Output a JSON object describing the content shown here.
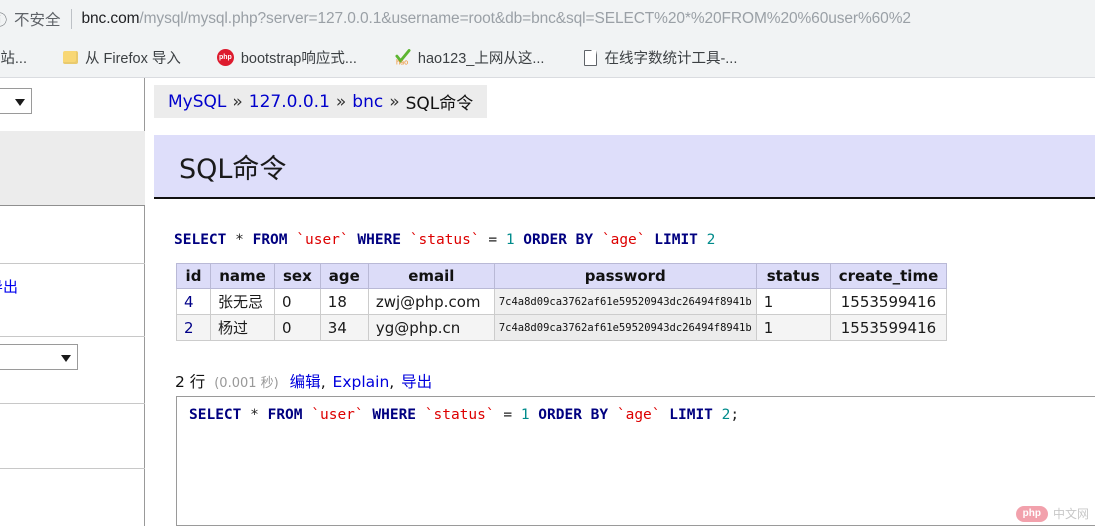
{
  "browser": {
    "security_label": "不安全",
    "info_icon": "info-circle-icon",
    "url_host": "bnc.com",
    "url_path": "/mysql/mysql.php?server=127.0.0.1&username=root&db=bnc&sql=SELECT%20*%20FROM%20%60user%60%2",
    "bookmarks": [
      {
        "label": "询 - 站...",
        "icon": "none"
      },
      {
        "label": "从 Firefox 导入",
        "icon": "folder-icon"
      },
      {
        "label": "bootstrap响应式...",
        "icon": "php-icon"
      },
      {
        "label": "hao123_上网从这...",
        "icon": "hao123-icon"
      },
      {
        "label": "在线字数统计工具-...",
        "icon": "document-icon"
      }
    ]
  },
  "nav": {
    "server_select_value": "",
    "db_select_value": "",
    "export_link": "导出"
  },
  "breadcrumb": {
    "items": [
      "MySQL",
      "127.0.0.1",
      "bnc",
      "SQL命令"
    ],
    "separator": "»"
  },
  "header": {
    "title": "SQL命令"
  },
  "query": {
    "echo_tokens": [
      {
        "t": "SELECT",
        "c": "kw"
      },
      {
        "t": " ",
        "c": "op"
      },
      {
        "t": "*",
        "c": "op"
      },
      {
        "t": " ",
        "c": "op"
      },
      {
        "t": "FROM",
        "c": "kw"
      },
      {
        "t": " ",
        "c": "op"
      },
      {
        "t": "`user`",
        "c": "idn"
      },
      {
        "t": " ",
        "c": "op"
      },
      {
        "t": "WHERE",
        "c": "kw"
      },
      {
        "t": " ",
        "c": "op"
      },
      {
        "t": "`status`",
        "c": "idn"
      },
      {
        "t": " = ",
        "c": "op"
      },
      {
        "t": "1",
        "c": "num"
      },
      {
        "t": " ",
        "c": "op"
      },
      {
        "t": "ORDER BY",
        "c": "kw"
      },
      {
        "t": " ",
        "c": "op"
      },
      {
        "t": "`age`",
        "c": "idn"
      },
      {
        "t": " ",
        "c": "op"
      },
      {
        "t": "LIMIT",
        "c": "kw"
      },
      {
        "t": " ",
        "c": "op"
      },
      {
        "t": "2",
        "c": "num"
      }
    ],
    "editor_tokens": [
      {
        "t": "SELECT",
        "c": "kw"
      },
      {
        "t": " ",
        "c": "op"
      },
      {
        "t": "*",
        "c": "op"
      },
      {
        "t": " ",
        "c": "op"
      },
      {
        "t": "FROM",
        "c": "kw"
      },
      {
        "t": " ",
        "c": "op"
      },
      {
        "t": "`user`",
        "c": "idn"
      },
      {
        "t": " ",
        "c": "op"
      },
      {
        "t": "WHERE",
        "c": "kw"
      },
      {
        "t": " ",
        "c": "op"
      },
      {
        "t": "`status`",
        "c": "idn"
      },
      {
        "t": " = ",
        "c": "op"
      },
      {
        "t": "1",
        "c": "num"
      },
      {
        "t": " ",
        "c": "op"
      },
      {
        "t": "ORDER BY",
        "c": "kw"
      },
      {
        "t": " ",
        "c": "op"
      },
      {
        "t": "`age`",
        "c": "idn"
      },
      {
        "t": " ",
        "c": "op"
      },
      {
        "t": "LIMIT",
        "c": "kw"
      },
      {
        "t": " ",
        "c": "op"
      },
      {
        "t": "2",
        "c": "num"
      },
      {
        "t": ";",
        "c": "op"
      }
    ],
    "editor_text": "SELECT * FROM `user` WHERE `status` = 1 ORDER BY `age` LIMIT 2;"
  },
  "results": {
    "columns": [
      "id",
      "name",
      "sex",
      "age",
      "email",
      "password",
      "status",
      "create_time"
    ],
    "rows": [
      {
        "id": "4",
        "name": "张无忌",
        "sex": "0",
        "age": "18",
        "email": "zwj@php.com",
        "password": "7c4a8d09ca3762af61e59520943dc26494f8941b",
        "status": "1",
        "create_time": "1553599416"
      },
      {
        "id": "2",
        "name": "杨过",
        "sex": "0",
        "age": "34",
        "email": "yg@php.cn",
        "password": "7c4a8d09ca3762af61e59520943dc26494f8941b",
        "status": "1",
        "create_time": "1553599416"
      }
    ]
  },
  "summary": {
    "row_count": "2 行",
    "timing": "(0.001 秒)",
    "actions": [
      "编辑",
      "Explain",
      "导出"
    ],
    "separator": ", "
  },
  "watermark": {
    "badge": "php",
    "text": "中文网"
  },
  "colors": {
    "accent_band": "#dedefa",
    "table_header": "#dcdcf8",
    "link": "#0000dd",
    "keyword": "#000080",
    "identifier": "#dd0000",
    "number": "#008b8b"
  }
}
